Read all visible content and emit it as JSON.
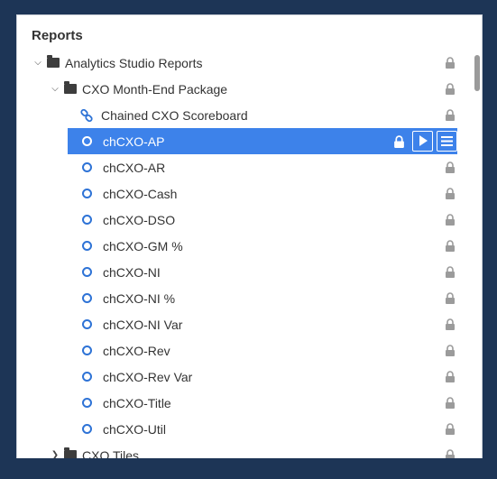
{
  "panel": {
    "title": "Reports"
  },
  "tree": {
    "root": {
      "label": "Analytics Studio Reports",
      "expanded": true,
      "locked": true
    },
    "package": {
      "label": "CXO Month-End Package",
      "expanded": true,
      "locked": true
    },
    "chained": {
      "label": "Chained CXO Scoreboard",
      "locked": true
    },
    "items": [
      {
        "label": "chCXO-AP",
        "selected": true
      },
      {
        "label": "chCXO-AR"
      },
      {
        "label": "chCXO-Cash"
      },
      {
        "label": "chCXO-DSO"
      },
      {
        "label": "chCXO-GM %"
      },
      {
        "label": "chCXO-NI"
      },
      {
        "label": "chCXO-NI %"
      },
      {
        "label": "chCXO-NI Var"
      },
      {
        "label": "chCXO-Rev"
      },
      {
        "label": "chCXO-Rev Var"
      },
      {
        "label": "chCXO-Title"
      },
      {
        "label": "chCXO-Util"
      }
    ],
    "tiles": {
      "label": "CXO Tiles",
      "expanded": false,
      "locked": true
    }
  },
  "icons": {
    "expanded": "chevron-down-icon",
    "collapsed": "chevron-right-icon",
    "folder": "folder-icon",
    "report": "report-dot-icon",
    "chained": "chain-link-icon",
    "lock": "lock-icon",
    "run": "play-icon",
    "menu": "hamburger-menu-icon"
  },
  "colors": {
    "frame": "#1d3556",
    "selection": "#3d82ea",
    "accent": "#2e73d6",
    "lock": "#9b9b9b"
  }
}
